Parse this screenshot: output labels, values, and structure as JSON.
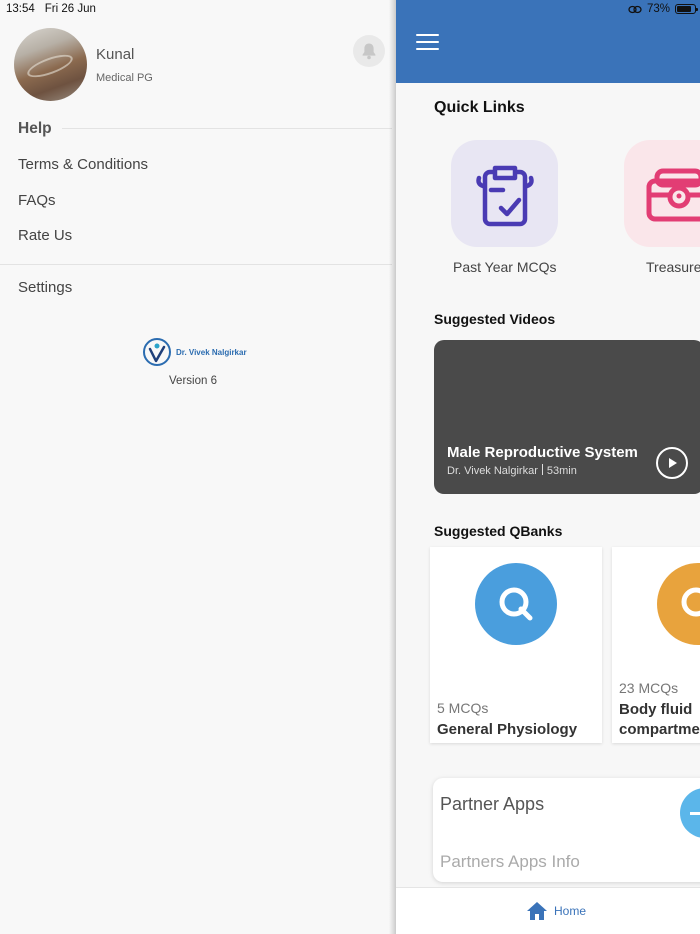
{
  "status_bar": {
    "time": "13:54",
    "date": "Fri 26 Jun",
    "battery": "73%"
  },
  "drawer": {
    "user": {
      "name": "Kunal",
      "subtitle": "Medical PG"
    },
    "help_heading": "Help",
    "items": [
      {
        "label": "Terms & Conditions"
      },
      {
        "label": "FAQs"
      },
      {
        "label": "Rate Us"
      },
      {
        "label": "Settings"
      }
    ],
    "logo_text": "Dr. Vivek Nalgirkar",
    "version": "Version 6"
  },
  "main": {
    "quick_links": {
      "title": "Quick Links",
      "items": [
        {
          "label": "Past Year MCQs",
          "icon": "clipboard-check-icon",
          "bg": "#e8e6f3",
          "color": "#4a3bb3"
        },
        {
          "label": "Treasure",
          "icon": "treasure-chest-icon",
          "bg": "#fae6ea",
          "color": "#e23d74"
        }
      ]
    },
    "suggested_videos": {
      "title": "Suggested Videos",
      "video": {
        "title": "Male Reproductive System",
        "author": "Dr. Vivek Nalgirkar",
        "duration": "53min"
      }
    },
    "suggested_qbanks": {
      "title": "Suggested QBanks",
      "items": [
        {
          "count": "5 MCQs",
          "name": "General Physiology",
          "color": "#4a9edd"
        },
        {
          "count": "23 MCQs",
          "name": "Body fluid",
          "name_line2": "compartme",
          "color": "#e8a33d"
        }
      ]
    },
    "partner_apps": {
      "title": "Partner Apps",
      "subtitle": "Partners Apps Info"
    },
    "bottom_nav": {
      "home_label": "Home"
    }
  },
  "colors": {
    "primary": "#3a73b9",
    "drawer_bg": "#f8f8f8"
  }
}
